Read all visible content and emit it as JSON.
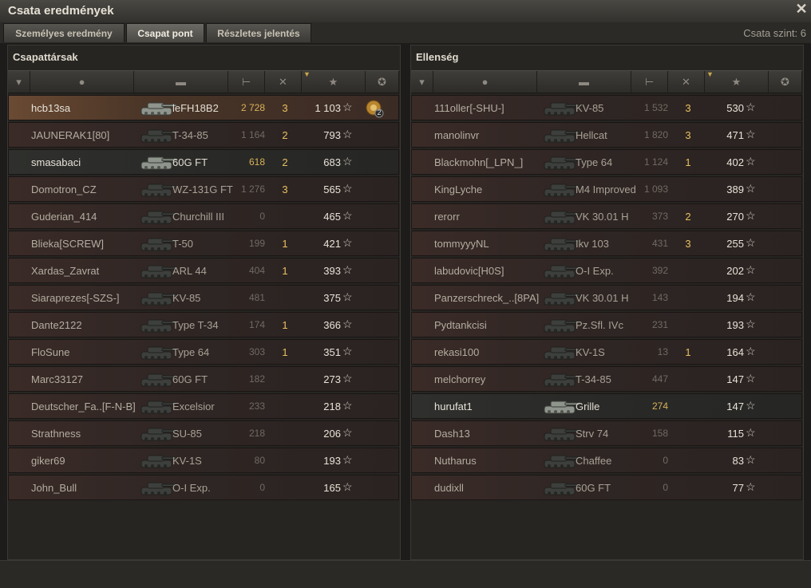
{
  "window": {
    "title": "Csata eredmények"
  },
  "tabs": [
    {
      "label": "Személyes eredmény"
    },
    {
      "label": "Csapat pont"
    },
    {
      "label": "Részletes jelentés"
    }
  ],
  "battle_level": "Csata szint: 6",
  "colors": {
    "kills": "#e8c060",
    "damage_alive": "#d9b25a",
    "damage_dead": "#6f6a62"
  },
  "allies": {
    "title": "Csapattársak",
    "rows": [
      {
        "name": "hcb13sa",
        "tank": "leFH18B2",
        "damage": "2 728",
        "kills": "3",
        "xp": "1 103",
        "status": "me",
        "medal": "2"
      },
      {
        "name": "JAUNERAK1[80]",
        "tank": "T-34-85",
        "damage": "1 164",
        "kills": "2",
        "xp": "793",
        "status": "dead"
      },
      {
        "name": "smasabaci",
        "tank": "60G FT",
        "damage": "618",
        "kills": "2",
        "xp": "683",
        "status": "alive"
      },
      {
        "name": "Domotron_CZ",
        "tank": "WZ-131G FT",
        "damage": "1 276",
        "kills": "3",
        "xp": "565",
        "status": "dead"
      },
      {
        "name": "Guderian_414",
        "tank": "Churchill III",
        "damage": "0",
        "kills": "",
        "xp": "465",
        "status": "dead"
      },
      {
        "name": "Blieka[SCREW]",
        "tank": "T-50",
        "damage": "199",
        "kills": "1",
        "xp": "421",
        "status": "dead"
      },
      {
        "name": "Xardas_Zavrat",
        "tank": "ARL 44",
        "damage": "404",
        "kills": "1",
        "xp": "393",
        "status": "dead"
      },
      {
        "name": "Siaraprezes[-SZS-]",
        "tank": "KV-85",
        "damage": "481",
        "kills": "",
        "xp": "375",
        "status": "dead"
      },
      {
        "name": "Dante2122",
        "tank": "Type T-34",
        "damage": "174",
        "kills": "1",
        "xp": "366",
        "status": "dead"
      },
      {
        "name": "FloSune",
        "tank": "Type 64",
        "damage": "303",
        "kills": "1",
        "xp": "351",
        "status": "dead"
      },
      {
        "name": "Marc33127",
        "tank": "60G FT",
        "damage": "182",
        "kills": "",
        "xp": "273",
        "status": "dead"
      },
      {
        "name": "Deutscher_Fa..[F-N-B]",
        "tank": "Excelsior",
        "damage": "233",
        "kills": "",
        "xp": "218",
        "status": "dead"
      },
      {
        "name": "Strathness",
        "tank": "SU-85",
        "damage": "218",
        "kills": "",
        "xp": "206",
        "status": "dead"
      },
      {
        "name": "giker69",
        "tank": "KV-1S",
        "damage": "80",
        "kills": "",
        "xp": "193",
        "status": "dead"
      },
      {
        "name": "John_Bull",
        "tank": "O-I Exp.",
        "damage": "0",
        "kills": "",
        "xp": "165",
        "status": "dead"
      }
    ]
  },
  "enemies": {
    "title": "Ellenség",
    "rows": [
      {
        "name": "111oller[-SHU-]",
        "tank": "KV-85",
        "damage": "1 532",
        "kills": "3",
        "xp": "530",
        "status": "dead"
      },
      {
        "name": "manolinvr",
        "tank": "Hellcat",
        "damage": "1 820",
        "kills": "3",
        "xp": "471",
        "status": "dead"
      },
      {
        "name": "Blackmohn[_LPN_]",
        "tank": "Type 64",
        "damage": "1 124",
        "kills": "1",
        "xp": "402",
        "status": "dead"
      },
      {
        "name": "KingLyche",
        "tank": "M4 Improved",
        "damage": "1 093",
        "kills": "",
        "xp": "389",
        "status": "dead"
      },
      {
        "name": "rerorr",
        "tank": "VK 30.01 H",
        "damage": "373",
        "kills": "2",
        "xp": "270",
        "status": "dead"
      },
      {
        "name": "tommyyyNL",
        "tank": "Ikv 103",
        "damage": "431",
        "kills": "3",
        "xp": "255",
        "status": "dead"
      },
      {
        "name": "labudovic[H0S]",
        "tank": "O-I Exp.",
        "damage": "392",
        "kills": "",
        "xp": "202",
        "status": "dead"
      },
      {
        "name": "Panzerschreck_..[8PA]",
        "tank": "VK 30.01 H",
        "damage": "143",
        "kills": "",
        "xp": "194",
        "status": "dead"
      },
      {
        "name": "Pydtankcisi",
        "tank": "Pz.Sfl. IVc",
        "damage": "231",
        "kills": "",
        "xp": "193",
        "status": "dead"
      },
      {
        "name": "rekasi100",
        "tank": "KV-1S",
        "damage": "13",
        "kills": "1",
        "xp": "164",
        "status": "dead"
      },
      {
        "name": "melchorrey",
        "tank": "T-34-85",
        "damage": "447",
        "kills": "",
        "xp": "147",
        "status": "dead"
      },
      {
        "name": "hurufat1",
        "tank": "Grille",
        "damage": "274",
        "kills": "",
        "xp": "147",
        "status": "alive"
      },
      {
        "name": "Dash13",
        "tank": "Strv 74",
        "damage": "158",
        "kills": "",
        "xp": "115",
        "status": "dead"
      },
      {
        "name": "Nutharus",
        "tank": "Chaffee",
        "damage": "0",
        "kills": "",
        "xp": "83",
        "status": "dead"
      },
      {
        "name": "dudixll",
        "tank": "60G FT",
        "damage": "0",
        "kills": "",
        "xp": "77",
        "status": "dead"
      }
    ]
  },
  "columns": [
    {
      "icon": "squad-icon"
    },
    {
      "icon": "player-icon"
    },
    {
      "icon": "tank-icon"
    },
    {
      "icon": "damage-icon"
    },
    {
      "icon": "kills-icon"
    },
    {
      "icon": "xp-star-icon"
    },
    {
      "icon": "medal-icon"
    }
  ]
}
